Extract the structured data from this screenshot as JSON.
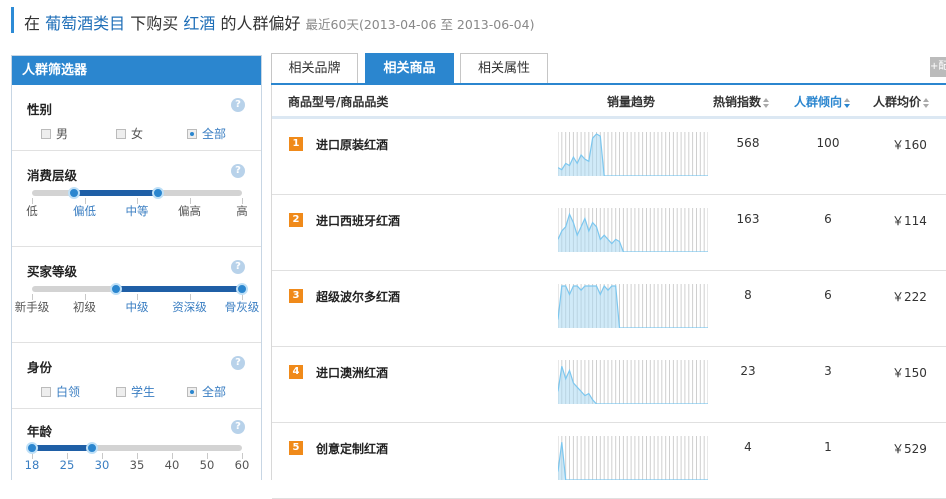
{
  "header": {
    "prefix": "在",
    "category": "葡萄酒类目",
    "middle": "下购买",
    "keyword": "红酒",
    "suffix": "的人群偏好",
    "range": "最近60天(2013-04-06 至 2013-06-04)"
  },
  "sidebar": {
    "title": "人群筛选器",
    "help": "?",
    "gender": {
      "label": "性别",
      "options": [
        {
          "label": "男",
          "checked": false
        },
        {
          "label": "女",
          "checked": false
        },
        {
          "label": "全部",
          "checked": true
        }
      ]
    },
    "consumption": {
      "label": "消费层级",
      "ticks": [
        "低",
        "偏低",
        "中等",
        "偏高",
        "高"
      ],
      "active": [
        1,
        2
      ],
      "range": [
        0.2,
        0.6
      ]
    },
    "buyer": {
      "label": "买家等级",
      "ticks": [
        "新手级",
        "初级",
        "中级",
        "资深级",
        "骨灰级"
      ],
      "active": [
        2,
        3,
        4
      ],
      "range": [
        0.4,
        1.0
      ]
    },
    "identity": {
      "label": "身份",
      "options": [
        {
          "label": "白领",
          "checked": false
        },
        {
          "label": "学生",
          "checked": false
        },
        {
          "label": "全部",
          "checked": true
        }
      ]
    },
    "age": {
      "label": "年龄",
      "ticks": [
        "18",
        "25",
        "30",
        "35",
        "40",
        "50",
        "60"
      ],
      "active": [
        0,
        1,
        2
      ],
      "range": [
        0.0,
        0.286
      ]
    }
  },
  "tabs": [
    {
      "label": "相关品牌",
      "active": false
    },
    {
      "label": "相关商品",
      "active": true
    },
    {
      "label": "相关属性",
      "active": false
    }
  ],
  "plus_label": "+配",
  "table": {
    "headers": {
      "name": "商品型号/商品品类",
      "trend": "销量趋势",
      "hot": "热销指数",
      "tendency": "人群倾向",
      "price": "人群均价"
    },
    "rows": [
      {
        "rank": "1",
        "name": "进口原装红酒",
        "hot": "568",
        "tendency": "100",
        "price": "￥160",
        "trend": [
          0.2,
          0.15,
          0.3,
          0.25,
          0.45,
          0.3,
          0.5,
          0.4,
          0.35,
          0.9,
          1.0,
          0.95,
          0,
          0,
          0,
          0,
          0,
          0,
          0,
          0,
          0,
          0,
          0,
          0,
          0,
          0,
          0,
          0,
          0,
          0,
          0,
          0,
          0,
          0,
          0,
          0,
          0,
          0,
          0,
          0
        ]
      },
      {
        "rank": "2",
        "name": "进口西班牙红酒",
        "hot": "163",
        "tendency": "6",
        "price": "￥114",
        "trend": [
          0.3,
          0.5,
          0.6,
          0.9,
          0.7,
          0.4,
          0.6,
          0.8,
          0.5,
          0.7,
          0.6,
          0.3,
          0.4,
          0.3,
          0.2,
          0.3,
          0.25,
          0,
          0,
          0,
          0,
          0,
          0,
          0,
          0,
          0,
          0,
          0,
          0,
          0,
          0,
          0,
          0,
          0,
          0,
          0,
          0,
          0,
          0,
          0
        ]
      },
      {
        "rank": "3",
        "name": "超级波尔多红酒",
        "hot": "8",
        "tendency": "6",
        "price": "￥222",
        "trend": [
          0.2,
          1,
          1,
          0.8,
          1,
          1,
          0.9,
          1,
          1,
          1,
          1,
          0.8,
          1,
          0.9,
          1,
          1,
          0,
          0,
          0,
          0,
          0,
          0,
          0,
          0,
          0,
          0,
          0,
          0,
          0,
          0,
          0,
          0,
          0,
          0,
          0,
          0,
          0,
          0,
          0,
          0
        ]
      },
      {
        "rank": "4",
        "name": "进口澳洲红酒",
        "hot": "23",
        "tendency": "3",
        "price": "￥150",
        "trend": [
          0.3,
          0.9,
          0.6,
          0.8,
          0.5,
          0.4,
          0.3,
          0.2,
          0.25,
          0.1,
          0,
          0,
          0,
          0,
          0,
          0,
          0,
          0,
          0,
          0,
          0,
          0,
          0,
          0,
          0,
          0,
          0,
          0,
          0,
          0,
          0,
          0,
          0,
          0,
          0,
          0,
          0,
          0,
          0,
          0
        ]
      },
      {
        "rank": "5",
        "name": "创意定制红酒",
        "hot": "4",
        "tendency": "1",
        "price": "￥529",
        "trend": [
          0.2,
          0.9,
          0,
          0,
          0,
          0,
          0,
          0,
          0,
          0,
          0,
          0,
          0,
          0,
          0,
          0,
          0,
          0,
          0,
          0,
          0,
          0,
          0,
          0,
          0,
          0,
          0,
          0,
          0,
          0,
          0,
          0,
          0,
          0,
          0,
          0,
          0,
          0,
          0,
          0
        ]
      }
    ]
  },
  "colors": {
    "accent": "#2b86cf",
    "rank": "#f08a1a",
    "spark": "#a9d8f3",
    "sparkGrid": "#cfcfcf"
  }
}
